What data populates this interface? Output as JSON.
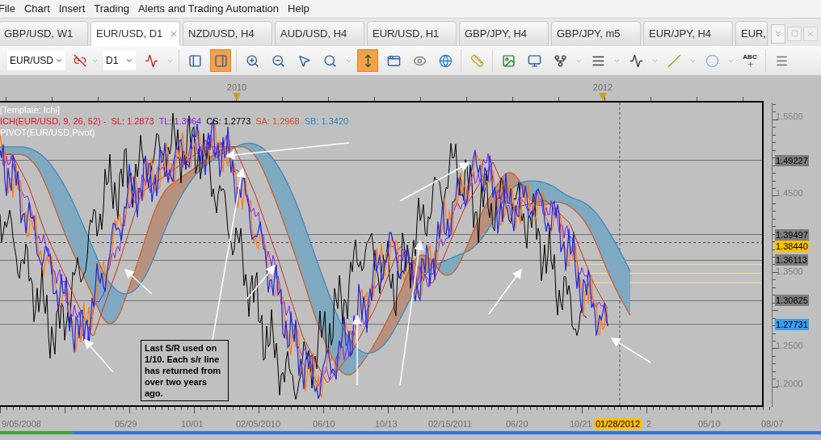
{
  "menu": [
    "File",
    "Chart",
    "Insert",
    "Trading",
    "Alerts and Trading Automation",
    "Help"
  ],
  "tabs": [
    {
      "label": "GBP/USD, W1",
      "selected": false
    },
    {
      "label": "EUR/USD, D1",
      "selected": true
    },
    {
      "label": "NZD/USD, H4",
      "selected": false
    },
    {
      "label": "AUD/USD, H4",
      "selected": false
    },
    {
      "label": "EUR/USD, H1",
      "selected": false
    },
    {
      "label": "GBP/JPY, H4",
      "selected": false
    },
    {
      "label": "GBP/JPY, m5",
      "selected": false
    },
    {
      "label": "EUR/JPY, H4",
      "selected": false
    },
    {
      "label": "EUR,",
      "selected": false
    }
  ],
  "toolbar": {
    "symbol": "EUR/USD",
    "timeframe": "D1",
    "tools": [
      {
        "kind": "indicator",
        "caret": true,
        "active": false
      },
      {
        "kind": "separator"
      },
      {
        "kind": "panel-left",
        "caret": false,
        "active": false
      },
      {
        "kind": "panel-right",
        "caret": false,
        "active": true
      },
      {
        "kind": "separator"
      },
      {
        "kind": "zoom-in",
        "caret": false,
        "active": false
      },
      {
        "kind": "zoom-out",
        "caret": false,
        "active": false
      },
      {
        "kind": "cursor",
        "caret": false,
        "active": false
      },
      {
        "kind": "zoom-fit",
        "caret": true,
        "active": false
      },
      {
        "kind": "vertical-scale",
        "caret": false,
        "active": true
      },
      {
        "kind": "edit-window",
        "caret": false,
        "active": false
      },
      {
        "kind": "eye",
        "caret": false,
        "active": false
      },
      {
        "kind": "globe",
        "caret": false,
        "active": false
      },
      {
        "kind": "separator"
      },
      {
        "kind": "ruler",
        "caret": false,
        "active": false
      },
      {
        "kind": "separator"
      },
      {
        "kind": "image",
        "caret": false,
        "active": false
      },
      {
        "kind": "window",
        "caret": false,
        "active": false
      },
      {
        "kind": "fork",
        "caret": true,
        "active": false
      },
      {
        "kind": "list",
        "caret": true,
        "active": false
      },
      {
        "kind": "fan",
        "caret": true,
        "active": false
      },
      {
        "kind": "line",
        "caret": true,
        "active": false
      },
      {
        "kind": "ellipse",
        "caret": true,
        "active": false
      },
      {
        "kind": "text",
        "label": "ABC",
        "caret": false,
        "active": false
      },
      {
        "kind": "separator"
      },
      {
        "kind": "menu",
        "caret": false,
        "active": false
      }
    ]
  },
  "chart": {
    "top_axis": [
      "2010",
      "2012"
    ],
    "legend": [
      {
        "text": "[Template: Ichi]",
        "color": "#ffffff"
      },
      {
        "text": "ICH(EUR/USD, 9, 26, 52) -",
        "color": "#e8102a"
      },
      {
        "text": "SL: 1.2873",
        "color": "#e8102a"
      },
      {
        "text": "TL: 1.3064",
        "color": "#7a1ee0"
      },
      {
        "text": "CS: 1.2773",
        "color": "#000000"
      },
      {
        "text": "SA: 1.2968",
        "color": "#d0502a"
      },
      {
        "text": "SB: 1.3420",
        "color": "#2a88c0"
      },
      {
        "text": "PIVOT(EUR/USD,Pivot)",
        "color": "#ffffff"
      }
    ],
    "note": "Last S/R used on 1/10. Each s/r line has returned from over two years ago.",
    "price_labels": [
      {
        "text": "1.5500",
        "kind": "tick"
      },
      {
        "text": "1.49227",
        "kind": "level"
      },
      {
        "text": "1.4500",
        "kind": "tick"
      },
      {
        "text": "1.39497",
        "kind": "level"
      },
      {
        "text": "1.38440",
        "kind": "current"
      },
      {
        "text": "1.36113",
        "kind": "level"
      },
      {
        "text": "1.3500",
        "kind": "tick"
      },
      {
        "text": "1.30825",
        "kind": "level"
      },
      {
        "text": "1.27731",
        "kind": "last"
      },
      {
        "text": "1.2500",
        "kind": "tick"
      },
      {
        "text": "1.2000",
        "kind": "tick"
      }
    ],
    "dates": [
      {
        "text": "9/05/2008",
        "highlighted": false
      },
      {
        "text": "05/29",
        "highlighted": false
      },
      {
        "text": "10/01",
        "highlighted": false
      },
      {
        "text": "02/05/2010",
        "highlighted": false
      },
      {
        "text": "06/10",
        "highlighted": false
      },
      {
        "text": "10/13",
        "highlighted": false
      },
      {
        "text": "02/15/2011",
        "highlighted": false
      },
      {
        "text": "06/20",
        "highlighted": false
      },
      {
        "text": "10/21",
        "highlighted": false
      },
      {
        "text": "01/28/2012",
        "highlighted": true
      },
      {
        "text": "2",
        "highlighted": false
      },
      {
        "text": "05/10",
        "highlighted": false
      },
      {
        "text": "08/07",
        "highlighted": false
      }
    ]
  }
}
